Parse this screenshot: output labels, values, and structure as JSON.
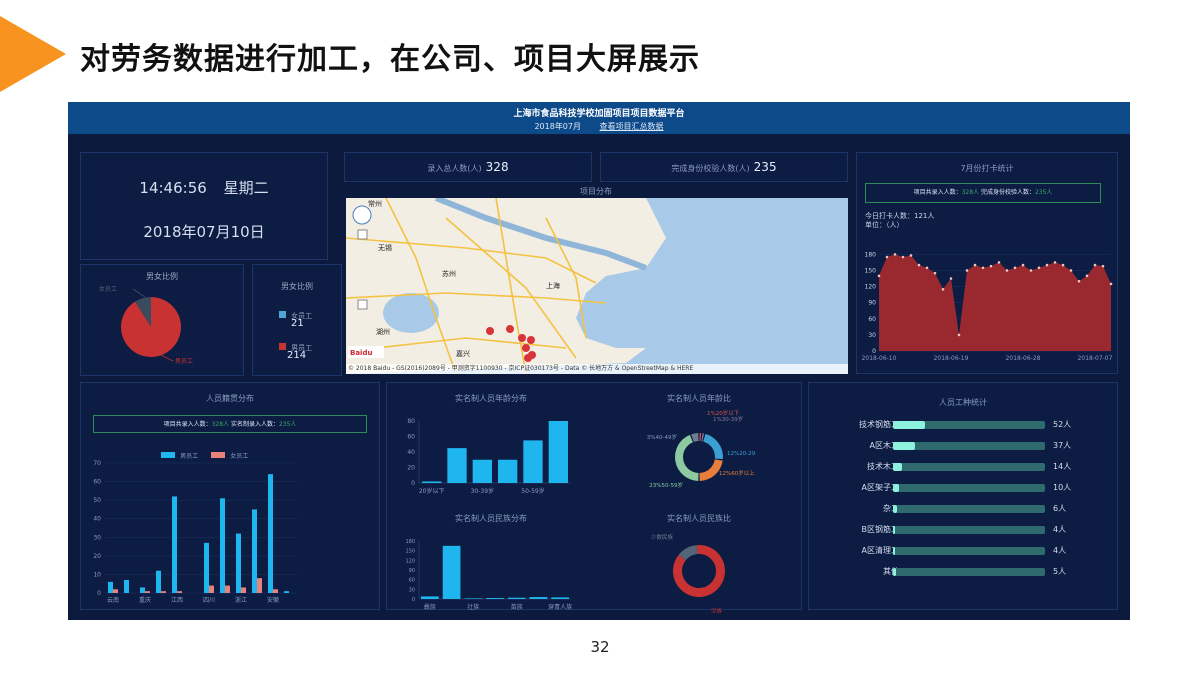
{
  "slide": {
    "title": "对劳务数据进行加工，在公司、项目大屏展示",
    "page_number": "32",
    "accent_color": "#f7931e"
  },
  "dashboard": {
    "header": {
      "title": "上海市食品科技学校加固项目项目数据平台",
      "month": "2018年07月",
      "summary_link": "查看项目汇总数据",
      "bg_color": "#0d4a8a"
    },
    "clock": {
      "time": "14:46:56",
      "weekday": "星期二",
      "date": "2018年07月10日"
    },
    "counters": [
      {
        "label": "录入总人数(人)",
        "value": "328"
      },
      {
        "label": "完成身份校验人数(人)",
        "value": "235"
      }
    ],
    "project_map": {
      "title": "项目分布",
      "city_labels": [
        "常州",
        "无锡",
        "苏州",
        "上海",
        "湖州",
        "嘉兴"
      ],
      "copyright": "© 2018 Baidu - GS(2016)2089号 - 甲测资字1100930 - 京ICP证030173号 - Data © 长地万方 & OpenStreetMap & HERE",
      "marker_count": 7,
      "marker_color": "#d9343a"
    },
    "gender_pie": {
      "title": "男女比例",
      "female_label": "女员工",
      "male_label": "男员工",
      "female": 21,
      "male": 214,
      "colors": {
        "male": "#c83232",
        "female": "#3c4a5e"
      }
    },
    "gender_summary": {
      "title": "男女比例",
      "female_label": "女员工",
      "female_value": "21",
      "male_label": "男员工",
      "male_value": "214",
      "female_color": "#4fa6d6",
      "male_color": "#c83232"
    },
    "checkin": {
      "title": "7月份打卡统计",
      "enrolled_label": "项目共录入人数：",
      "enrolled_value": "328人",
      "verified_label": "完成身份校验人数：",
      "verified_value": "235人",
      "today_label": "今日打卡人数：121人",
      "unit_label": "单位：（人）"
    },
    "origin": {
      "title": "人员籍贯分布",
      "enrolled_label": "项目共录入人数：",
      "enrolled_value": "328人",
      "formal_label": "实名制录入人数：",
      "formal_value": "235人",
      "legend_male": "男员工",
      "legend_female": "女员工"
    },
    "age_bars": {
      "title": "实名制人员年龄分布"
    },
    "age_donut": {
      "title": "实名制人员年龄比",
      "labels": [
        "1%20岁以下",
        "1%30-39岁",
        "12%20-29",
        "12%60岁以上",
        "23%50-59岁",
        "3%40-49岁"
      ]
    },
    "ethnic_bars": {
      "title": "实名制人员民族分布"
    },
    "ethnic_donut": {
      "title": "实名制人员民族比",
      "labels": [
        "少数民族",
        "汉族"
      ]
    },
    "worker_types": {
      "title": "人员工种统计",
      "items": [
        {
          "label": "技术钢筋工",
          "value": "52人",
          "count": 52
        },
        {
          "label": "A区木工",
          "value": "37人",
          "count": 37
        },
        {
          "label": "技术木工",
          "value": "14人",
          "count": 14
        },
        {
          "label": "A区架子工",
          "value": "10人",
          "count": 10
        },
        {
          "label": "杂工",
          "value": "6人",
          "count": 6
        },
        {
          "label": "B区钢筋工",
          "value": "4人",
          "count": 4
        },
        {
          "label": "A区清理工",
          "value": "4人",
          "count": 4
        },
        {
          "label": "其他",
          "value": "5人",
          "count": 5
        }
      ]
    }
  },
  "chart_data": [
    {
      "type": "area",
      "title": "7月份打卡统计",
      "x": [
        "2018-06-10",
        "2018-06-11",
        "2018-06-12",
        "2018-06-13",
        "2018-06-14",
        "2018-06-15",
        "2018-06-16",
        "2018-06-17",
        "2018-06-18",
        "2018-06-19",
        "2018-06-20",
        "2018-06-21",
        "2018-06-22",
        "2018-06-23",
        "2018-06-24",
        "2018-06-25",
        "2018-06-26",
        "2018-06-27",
        "2018-06-28",
        "2018-06-29",
        "2018-06-30",
        "2018-07-01",
        "2018-07-02",
        "2018-07-03",
        "2018-07-04",
        "2018-07-05",
        "2018-07-06",
        "2018-07-07",
        "2018-07-08",
        "2018-07-09"
      ],
      "x_ticks": [
        "2018-06-10",
        "2018-06-19",
        "2018-06-28",
        "2018-07-07"
      ],
      "values": [
        140,
        175,
        180,
        175,
        178,
        160,
        155,
        145,
        115,
        135,
        30,
        150,
        160,
        155,
        158,
        165,
        150,
        155,
        160,
        150,
        155,
        160,
        165,
        160,
        150,
        130,
        140,
        160,
        158,
        125
      ],
      "yticks": [
        0,
        30,
        60,
        90,
        120,
        150,
        180
      ],
      "ylim": [
        0,
        190
      ],
      "color": "#a12a2e"
    },
    {
      "type": "bar",
      "title": "人员籍贯分布",
      "categories": [
        "云南",
        "",
        "重庆",
        "",
        "江西",
        "",
        "四川",
        "",
        "浙江",
        "",
        "安徽"
      ],
      "x_tick_labels": [
        "云南",
        "重庆",
        "江西",
        "四川",
        "浙江",
        "安徽"
      ],
      "series": [
        {
          "name": "男员工",
          "values": [
            6,
            7,
            3,
            12,
            52,
            0,
            27,
            51,
            32,
            45,
            64
          ],
          "color": "#1fb5ee"
        },
        {
          "name": "女员工",
          "values": [
            2,
            0,
            1,
            1,
            1,
            0,
            4,
            4,
            3,
            8,
            2
          ],
          "color": "#e8827a"
        }
      ],
      "trailing_value": 1,
      "yticks": [
        0,
        10,
        20,
        30,
        40,
        50,
        60,
        70
      ],
      "ylim": [
        0,
        70
      ]
    },
    {
      "type": "bar",
      "title": "实名制人员年龄分布",
      "categories": [
        "20岁以下",
        "",
        "30-39岁",
        "",
        "50-59岁",
        ""
      ],
      "x_tick_labels": [
        "20岁以下",
        "30-39岁",
        "50-59岁"
      ],
      "values": [
        2,
        45,
        30,
        30,
        55,
        80
      ],
      "yticks": [
        0,
        20,
        40,
        60,
        80
      ],
      "ylim": [
        0,
        80
      ],
      "color": "#1fb5ee"
    },
    {
      "type": "pie",
      "title": "实名制人员年龄比",
      "categories": [
        "20岁以下",
        "30-39岁",
        "20-29",
        "60岁以上",
        "50-59岁",
        "40-49岁"
      ],
      "values": [
        1,
        1,
        12,
        12,
        23,
        3
      ],
      "colors": [
        "#d9534f",
        "#8a7a9a",
        "#3b9fd4",
        "#e87e3c",
        "#8cc8a0",
        "#6b7d8f"
      ]
    },
    {
      "type": "bar",
      "title": "实名制人员民族分布",
      "categories": [
        "彝族",
        "",
        "壮族",
        "",
        "苗族",
        "",
        "穿青人族"
      ],
      "x_tick_labels": [
        "彝族",
        "壮族",
        "苗族",
        "穿青人族"
      ],
      "values": [
        8,
        165,
        2,
        3,
        4,
        6,
        5
      ],
      "yticks": [
        0,
        30,
        60,
        90,
        120,
        150,
        180
      ],
      "ylim": [
        0,
        180
      ],
      "color": "#1fb5ee"
    },
    {
      "type": "pie",
      "title": "实名制人员民族比",
      "categories": [
        "少数民族",
        "汉族"
      ],
      "values": [
        13,
        87
      ],
      "colors": [
        "#556578",
        "#c83232"
      ]
    }
  ]
}
